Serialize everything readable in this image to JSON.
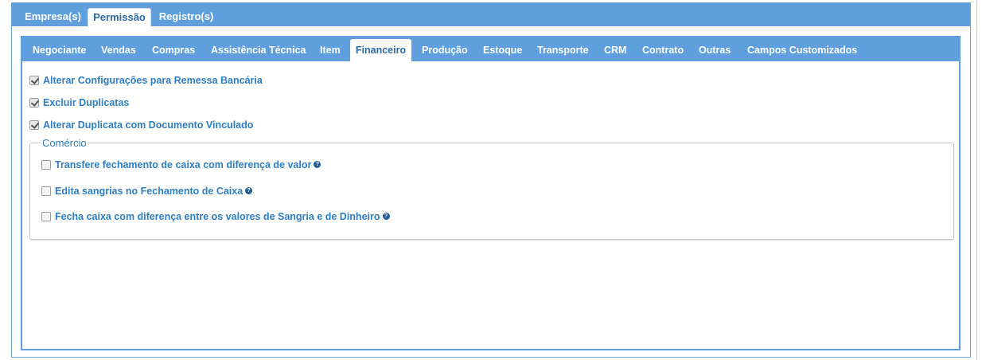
{
  "outer_tabs": [
    {
      "label": "Empresa(s)",
      "active": false
    },
    {
      "label": "Permissão",
      "active": true
    },
    {
      "label": "Registro(s)",
      "active": false
    }
  ],
  "inner_tabs": [
    {
      "label": "Negociante",
      "active": false
    },
    {
      "label": "Vendas",
      "active": false
    },
    {
      "label": "Compras",
      "active": false
    },
    {
      "label": "Assistência Técnica",
      "active": false
    },
    {
      "label": "Item",
      "active": false
    },
    {
      "label": "Financeiro",
      "active": true
    },
    {
      "label": "Produção",
      "active": false
    },
    {
      "label": "Estoque",
      "active": false
    },
    {
      "label": "Transporte",
      "active": false
    },
    {
      "label": "CRM",
      "active": false
    },
    {
      "label": "Contrato",
      "active": false
    },
    {
      "label": "Outras",
      "active": false
    },
    {
      "label": "Campos Customizados",
      "active": false
    }
  ],
  "permissions": [
    {
      "label": "Alterar Configurações para Remessa Bancária",
      "checked": true
    },
    {
      "label": "Excluir Duplicatas",
      "checked": true
    },
    {
      "label": "Alterar Duplicata com Documento Vinculado",
      "checked": true
    }
  ],
  "comercio": {
    "legend": "Comércio",
    "items": [
      {
        "label": "Transfere fechamento de caixa com diferença de valor",
        "checked": false,
        "help_icon": "question-circle-icon"
      },
      {
        "label": "Edita sangrias no Fechamento de Caixa",
        "checked": false,
        "help_icon": "question-circle-icon"
      },
      {
        "label": "Fecha caixa com diferença entre os valores de Sangria e de Dinheiro",
        "checked": false,
        "help_icon": "question-circle-icon"
      }
    ]
  },
  "colors": {
    "tab_bar": "#5f9fdd",
    "label_text": "#2f7ec1",
    "active_tab_text": "#2c6aa7",
    "help_icon": "#1e5c93"
  }
}
